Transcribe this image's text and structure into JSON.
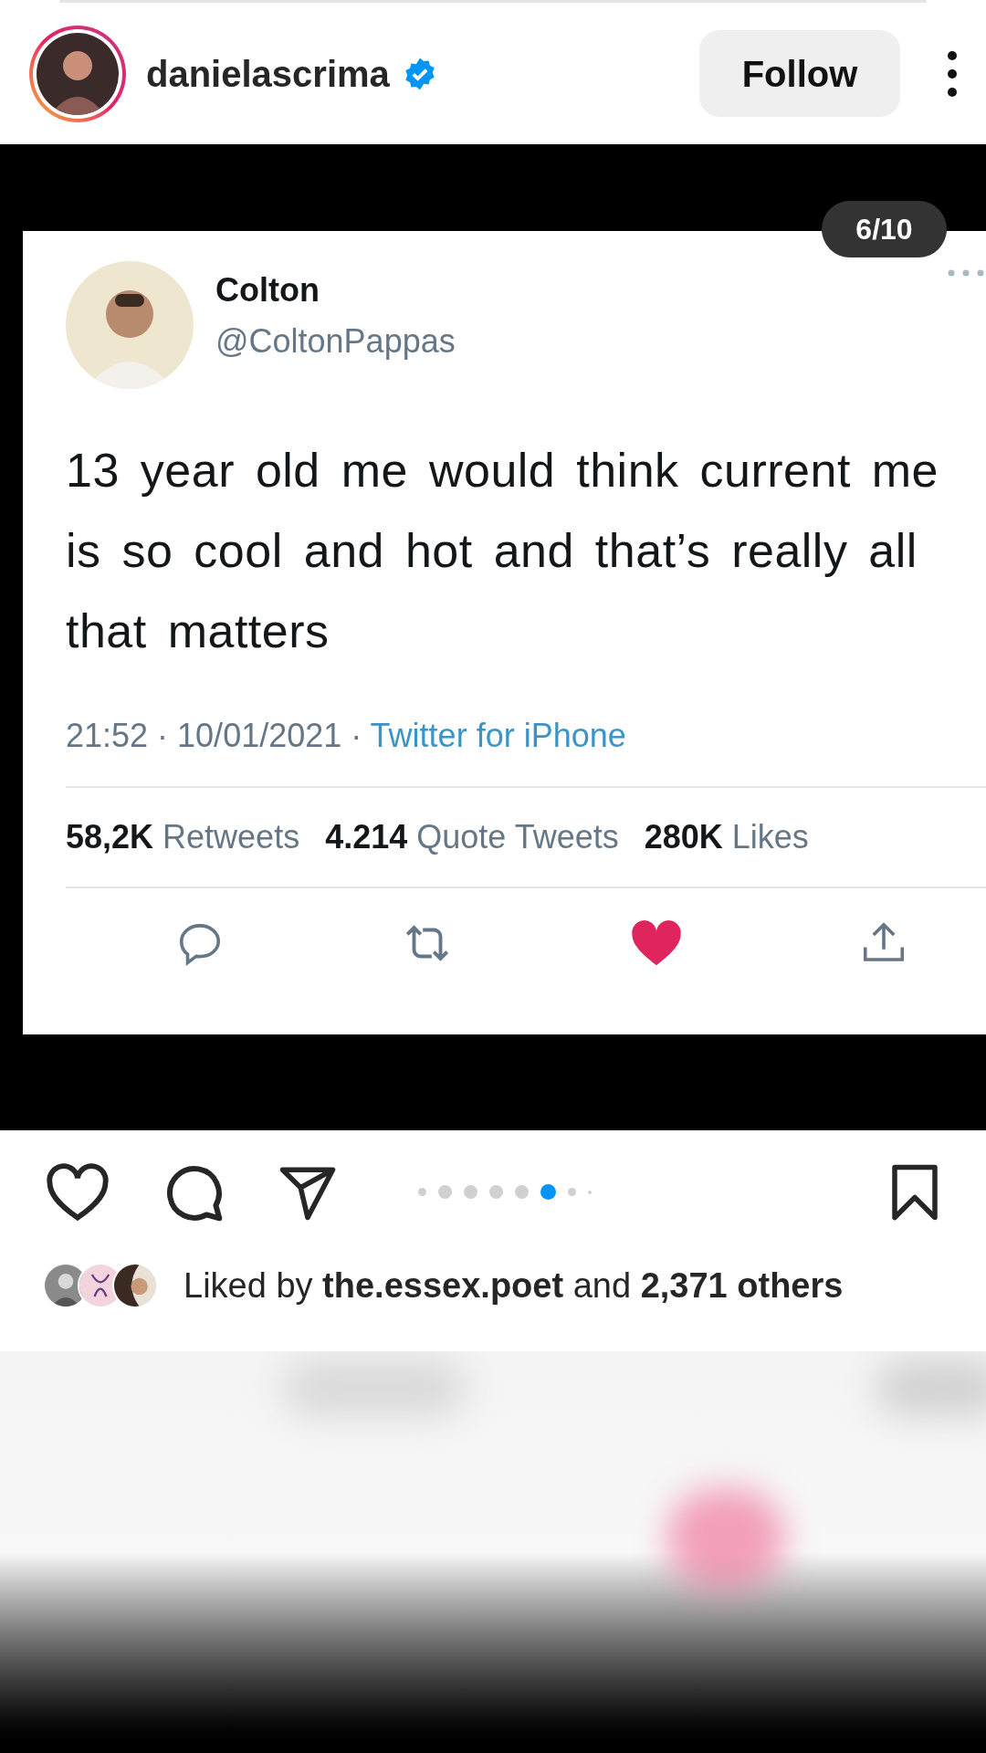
{
  "post_header": {
    "username": "danielascrima",
    "verified": true,
    "follow_button": "Follow"
  },
  "carousel": {
    "counter": "6/10",
    "dots": [
      {
        "selected": false
      },
      {
        "selected": false
      },
      {
        "selected": false
      },
      {
        "selected": false
      },
      {
        "selected": false
      },
      {
        "selected": true
      },
      {
        "selected": false
      },
      {
        "selected": false
      }
    ]
  },
  "tweet": {
    "name": "Colton",
    "handle": "@ColtonPappas",
    "text": "13 year old me would think current me is so cool and hot and that’s really all that matters",
    "time": "21:52 · 10/01/2021 · ",
    "source": "Twitter for iPhone",
    "stats": [
      {
        "count": "58,2K",
        "label": "Retweets"
      },
      {
        "count": "4.214",
        "label": "Quote Tweets"
      },
      {
        "count": "280K",
        "label": "Likes"
      }
    ],
    "liked": true
  },
  "likes": {
    "prefix": "Liked by ",
    "user": "the.essex.poet",
    "middle": " and ",
    "count": "2,371 others"
  }
}
